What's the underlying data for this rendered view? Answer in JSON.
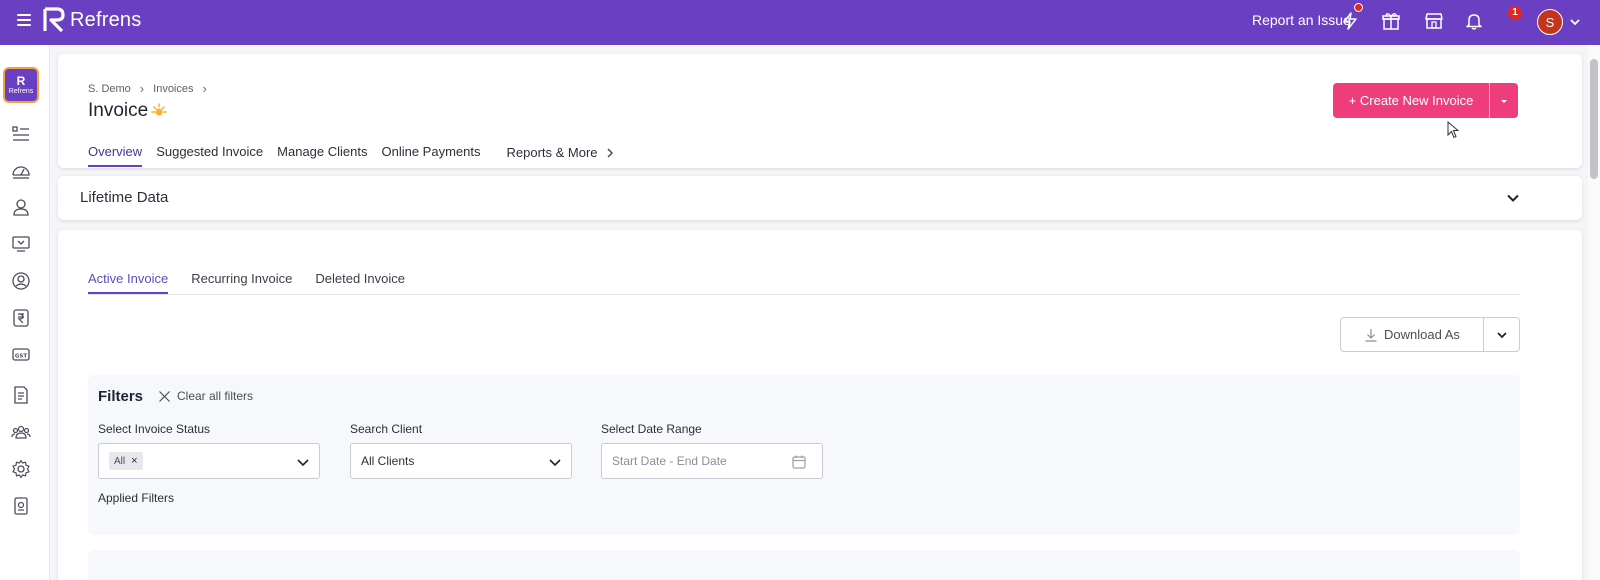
{
  "topbar": {
    "brand_name": "Refrens",
    "report_issue": "Report an Issue",
    "notification_count": "1",
    "avatar_initial": "S",
    "colors": {
      "bar": "#6a3fc2",
      "badge": "#e3261f",
      "avatar": "#c5341c"
    },
    "icons": [
      "menu-icon",
      "bolt-icon",
      "gift-icon",
      "store-icon",
      "bell-icon",
      "chevron-down-icon"
    ]
  },
  "sidebar": {
    "logo_text": "Refrens",
    "items": [
      {
        "icon": "list-icon"
      },
      {
        "icon": "dashboard-icon"
      },
      {
        "icon": "user-icon"
      },
      {
        "icon": "monitor-icon"
      },
      {
        "icon": "account-icon"
      },
      {
        "icon": "rupee-icon"
      },
      {
        "icon": "gst-icon"
      },
      {
        "icon": "document-icon"
      },
      {
        "icon": "team-icon"
      },
      {
        "icon": "settings-icon"
      },
      {
        "icon": "badge-icon"
      }
    ]
  },
  "header": {
    "breadcrumb": [
      "S. Demo",
      "Invoices"
    ],
    "title": "Invoice",
    "tabs": [
      {
        "label": "Overview",
        "active": true
      },
      {
        "label": "Suggested Invoice",
        "active": false
      },
      {
        "label": "Manage Clients",
        "active": false
      },
      {
        "label": "Online Payments",
        "active": false
      }
    ],
    "more_tab": "Reports & More",
    "create_button": "+ Create New Invoice",
    "create_color": "#ef3d7b"
  },
  "lifetime": {
    "title": "Lifetime Data"
  },
  "main": {
    "sub_tabs": [
      {
        "label": "Active Invoice",
        "active": true
      },
      {
        "label": "Recurring Invoice",
        "active": false
      },
      {
        "label": "Deleted Invoice",
        "active": false
      }
    ],
    "download_label": "Download As",
    "filters": {
      "title": "Filters",
      "clear_label": "Clear all filters",
      "status": {
        "label": "Select Invoice Status",
        "chip": "All"
      },
      "client": {
        "label": "Search Client",
        "value": "All Clients"
      },
      "date": {
        "label": "Select Date Range",
        "placeholder": "Start Date - End Date"
      },
      "applied_label": "Applied Filters"
    }
  }
}
